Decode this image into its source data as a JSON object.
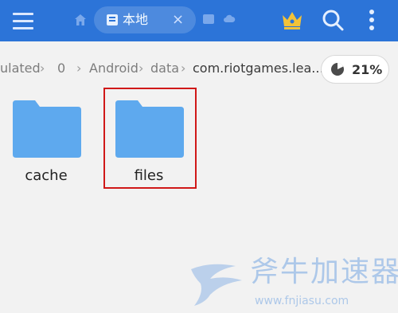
{
  "topbar": {
    "tab_label": "本地",
    "tab_close": "×",
    "icons": [
      "menu-icon",
      "home-icon",
      "folder-tab-icon",
      "close-icon",
      "tab-icon",
      "cloud-icon",
      "crown-icon",
      "search-icon",
      "more-vertical-icon"
    ]
  },
  "breadcrumb": {
    "items": [
      "ulated",
      "0",
      "Android",
      "data",
      "com.riotgames.lea..."
    ],
    "separator": "›"
  },
  "storage": {
    "percent_label": "21%",
    "used_fraction": 0.21
  },
  "files": [
    {
      "name": "cache"
    },
    {
      "name": "files"
    }
  ],
  "watermark": {
    "text": "斧牛加速器",
    "url": "www.fnjiasu.com"
  },
  "colors": {
    "appbar": "#2c74d8",
    "folder": "#5ea9ee",
    "highlight": "#d01818"
  }
}
